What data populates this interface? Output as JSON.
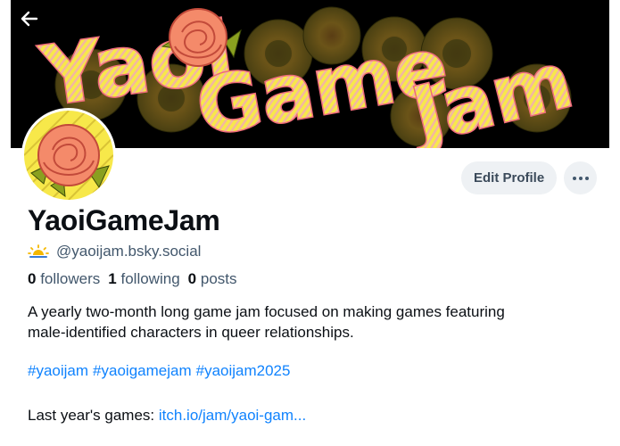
{
  "header": {
    "back_icon": "arrow-left-icon",
    "banner_text": [
      "Yaoi",
      "Game",
      "Jam"
    ]
  },
  "profile": {
    "display_name": "YaoiGameJam",
    "handle": "@yaoijam.bsky.social",
    "status_icon": "sun-horizon-icon",
    "stats": {
      "followers_count": "0",
      "followers_label": "followers",
      "following_count": "1",
      "following_label": "following",
      "posts_count": "0",
      "posts_label": "posts"
    },
    "bio_line1": "A yearly two-month long game jam focused on making games featuring",
    "bio_line2": "male-identified characters in queer relationships.",
    "hashtags": [
      "#yaoijam",
      "#yaoigamejam",
      "#yaoijam2025"
    ],
    "games_label": "Last year's games: ",
    "games_link": "itch.io/jam/yaoi-gam..."
  },
  "actions": {
    "edit_label": "Edit Profile",
    "more_icon": "ellipsis-icon"
  },
  "colors": {
    "link": "#1083fe",
    "muted": "#42576c",
    "button_bg": "#eef1f4",
    "banner_yellow": "#f7e84a",
    "banner_pink": "#ef6b7a",
    "rose": "#f48a6a"
  }
}
